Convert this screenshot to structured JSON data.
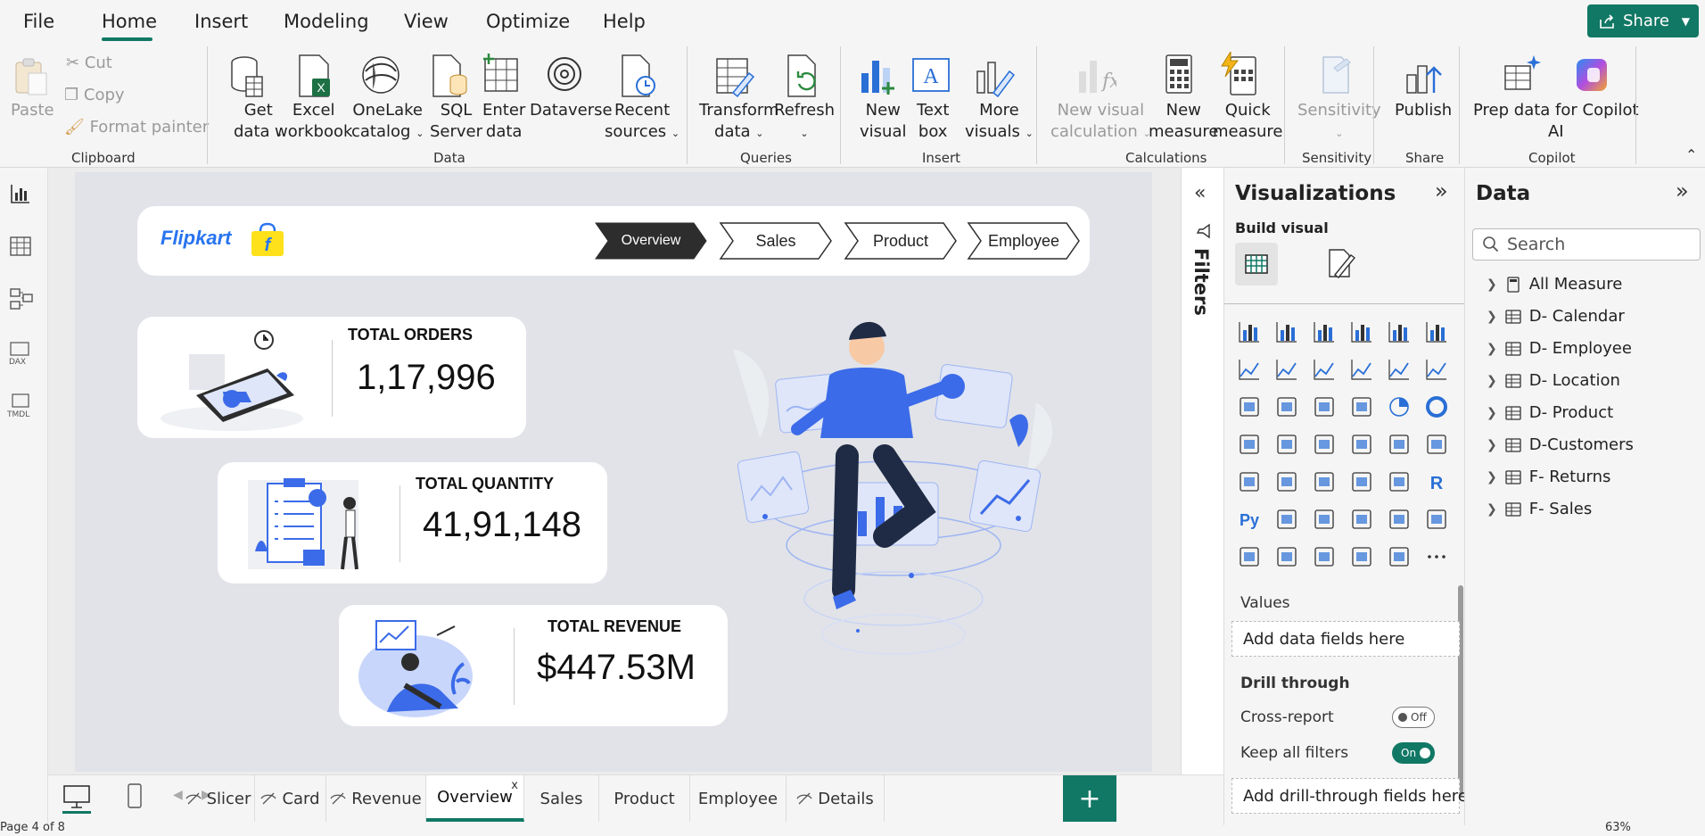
{
  "menu": {
    "file": "File",
    "home": "Home",
    "insert": "Insert",
    "modeling": "Modeling",
    "view": "View",
    "optimize": "Optimize",
    "help": "Help",
    "share": "Share"
  },
  "ribbon": {
    "clipboard": {
      "paste": "Paste",
      "cut": "Cut",
      "copy": "Copy",
      "format_painter": "Format painter",
      "group": "Clipboard"
    },
    "data": {
      "get_data_1": "Get",
      "get_data_2": "data",
      "excel_1": "Excel",
      "excel_2": "workbook",
      "onelake_1": "OneLake",
      "onelake_2": "catalog",
      "sql_1": "SQL",
      "sql_2": "Server",
      "enter_1": "Enter",
      "enter_2": "data",
      "dataverse": "Dataverse",
      "recent_1": "Recent",
      "recent_2": "sources",
      "group": "Data"
    },
    "queries": {
      "transform_1": "Transform",
      "transform_2": "data",
      "refresh": "Refresh",
      "group": "Queries"
    },
    "insert": {
      "new_visual_1": "New",
      "new_visual_2": "visual",
      "textbox_1": "Text",
      "textbox_2": "box",
      "more_visuals_1": "More",
      "more_visuals_2": "visuals",
      "group": "Insert"
    },
    "calculations": {
      "new_visual_calc_1": "New visual",
      "new_visual_calc_2": "calculation",
      "new_measure_1": "New",
      "new_measure_2": "measure",
      "quick_measure_1": "Quick",
      "quick_measure_2": "measure",
      "group": "Calculations"
    },
    "sensitivity": {
      "label": "Sensitivity",
      "group": "Sensitivity"
    },
    "share": {
      "publish": "Publish",
      "group": "Share"
    },
    "copilot": {
      "prep_1": "Prep data for Copilot",
      "prep_2": "AI",
      "copilot_label": "Copilot",
      "group": "Copilot"
    }
  },
  "report": {
    "brand": "Flipkart",
    "nav": [
      "Overview",
      "Sales",
      "Product",
      "Employee"
    ],
    "kpis": [
      {
        "title": "TOTAL ORDERS",
        "value": "1,17,996"
      },
      {
        "title": "TOTAL QUANTITY",
        "value": "41,91,148"
      },
      {
        "title": "TOTAL REVENUE",
        "value": "$447.53M"
      }
    ]
  },
  "filters": {
    "label": "Filters"
  },
  "visualizations": {
    "title": "Visualizations",
    "build_visual": "Build visual",
    "values": "Values",
    "add_data_fields": "Add data fields here",
    "drill_through": "Drill through",
    "cross_report": "Cross-report",
    "cross_report_state": "Off",
    "keep_all_filters": "Keep all filters",
    "keep_all_filters_state": "On",
    "add_drill_fields": "Add drill-through fields here"
  },
  "data_pane": {
    "title": "Data",
    "search_placeholder": "Search",
    "items": [
      "All Measure",
      "D- Calendar",
      "D- Employee",
      "D- Location",
      "D- Product",
      "D-Customers",
      "F- Returns",
      "F- Sales"
    ]
  },
  "tabs": [
    "Slicer",
    "Card",
    "Revenue",
    "Overview",
    "Sales",
    "Product",
    "Employee",
    "Details"
  ],
  "status": {
    "page": "Page 4 of 8",
    "zoom": "63%"
  },
  "colors": {
    "accent": "#117865",
    "brand_blue": "#2874f0",
    "illustration": "#3b6be8"
  }
}
